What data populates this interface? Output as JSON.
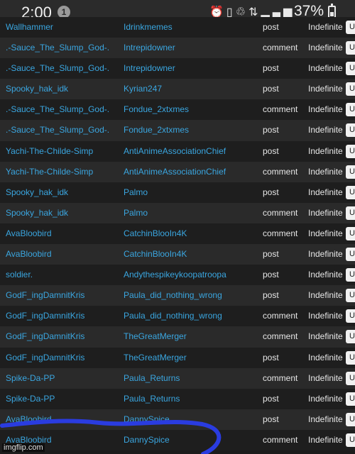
{
  "status_bar": {
    "time": "2:00",
    "notification_count": "1",
    "battery": "37%",
    "icons": [
      "alarm-icon",
      "vibrate-icon",
      "battery-saver-icon",
      "4g-lte-icon",
      "signal-icon"
    ]
  },
  "table": {
    "rows": [
      {
        "user": "Wallhammer",
        "target": "Idrinkmemes",
        "type": "post",
        "duration": "Indefinite",
        "action": "U"
      },
      {
        "user": ".-Sauce_The_Slump_God-.",
        "target": "Intrepidowner",
        "type": "comment",
        "duration": "Indefinite",
        "action": "U"
      },
      {
        "user": ".-Sauce_The_Slump_God-.",
        "target": "Intrepidowner",
        "type": "post",
        "duration": "Indefinite",
        "action": "U"
      },
      {
        "user": "Spooky_hak_idk",
        "target": "Kyrian247",
        "type": "post",
        "duration": "Indefinite",
        "action": "U"
      },
      {
        "user": ".-Sauce_The_Slump_God-.",
        "target": "Fondue_2xtxmes",
        "type": "comment",
        "duration": "Indefinite",
        "action": "U"
      },
      {
        "user": ".-Sauce_The_Slump_God-.",
        "target": "Fondue_2xtxmes",
        "type": "post",
        "duration": "Indefinite",
        "action": "U"
      },
      {
        "user": "Yachi-The-Childe-Simp",
        "target": "AntiAnimeAssociationChief",
        "type": "post",
        "duration": "Indefinite",
        "action": "U"
      },
      {
        "user": "Yachi-The-Childe-Simp",
        "target": "AntiAnimeAssociationChief",
        "type": "comment",
        "duration": "Indefinite",
        "action": "U"
      },
      {
        "user": "Spooky_hak_idk",
        "target": "Palmo",
        "type": "post",
        "duration": "Indefinite",
        "action": "U"
      },
      {
        "user": "Spooky_hak_idk",
        "target": "Palmo",
        "type": "comment",
        "duration": "Indefinite",
        "action": "U"
      },
      {
        "user": "AvaBloobird",
        "target": "CatchinBlooIn4K",
        "type": "comment",
        "duration": "Indefinite",
        "action": "U"
      },
      {
        "user": "AvaBloobird",
        "target": "CatchinBlooIn4K",
        "type": "post",
        "duration": "Indefinite",
        "action": "U"
      },
      {
        "user": "soldier.",
        "target": "Andythespikeykoopatroopa",
        "type": "post",
        "duration": "Indefinite",
        "action": "U"
      },
      {
        "user": "GodF_ingDamnitKris",
        "target": "Paula_did_nothing_wrong",
        "type": "post",
        "duration": "Indefinite",
        "action": "U"
      },
      {
        "user": "GodF_ingDamnitKris",
        "target": "Paula_did_nothing_wrong",
        "type": "comment",
        "duration": "Indefinite",
        "action": "U"
      },
      {
        "user": "GodF_ingDamnitKris",
        "target": "TheGreatMerger",
        "type": "comment",
        "duration": "Indefinite",
        "action": "U"
      },
      {
        "user": "GodF_ingDamnitKris",
        "target": "TheGreatMerger",
        "type": "post",
        "duration": "Indefinite",
        "action": "U"
      },
      {
        "user": "Spike-Da-PP",
        "target": "Paula_Returns",
        "type": "comment",
        "duration": "Indefinite",
        "action": "U"
      },
      {
        "user": "Spike-Da-PP",
        "target": "Paula_Returns",
        "type": "post",
        "duration": "Indefinite",
        "action": "U"
      },
      {
        "user": "AvaBloobird",
        "target": "DannySpice",
        "type": "post",
        "duration": "Indefinite",
        "action": "U"
      },
      {
        "user": "AvaBloobird",
        "target": "DannySpice",
        "type": "comment",
        "duration": "Indefinite",
        "action": "U"
      }
    ]
  },
  "annotation": {
    "color": "#2a3ce0"
  },
  "watermark": "imgflip.com"
}
